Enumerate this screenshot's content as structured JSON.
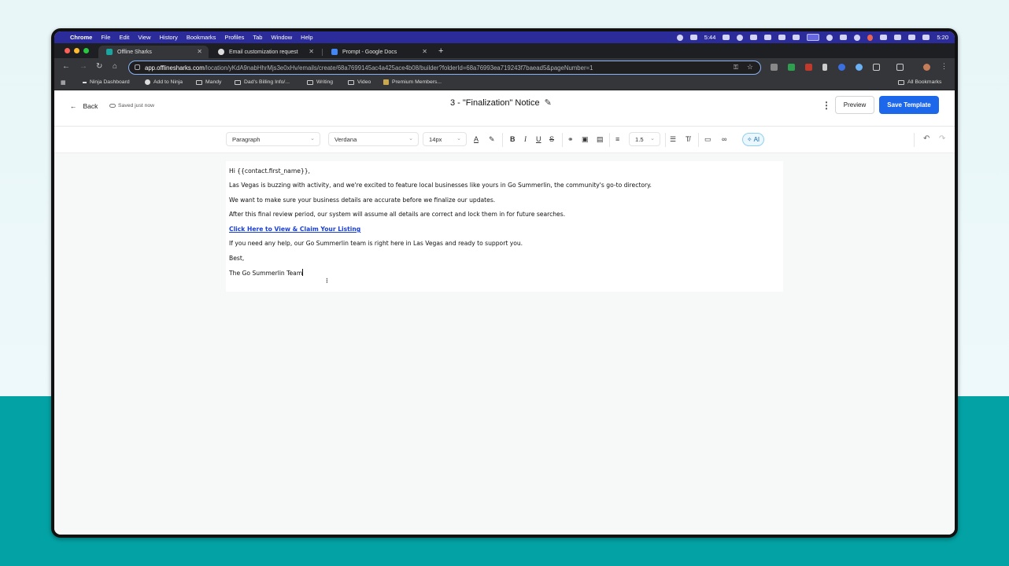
{
  "menubar": {
    "app": "Chrome",
    "items": [
      "File",
      "Edit",
      "View",
      "History",
      "Bookmarks",
      "Profiles",
      "Tab",
      "Window",
      "Help"
    ],
    "timer": "5:44",
    "clock": "5:20"
  },
  "tabs": [
    {
      "label": "Offline Sharks",
      "active": true
    },
    {
      "label": "Email customization request",
      "active": false
    },
    {
      "label": "Prompt - Google Docs",
      "active": false
    }
  ],
  "omnibox": {
    "host": "app.offlinesharks.com",
    "path": "/location/yKdA9nabHhrMjs3e0xHv/emails/create/68a7699145ac4a425ace4b08/builder?folderId=68a76993ea719243f7baead5&pageNumber=1"
  },
  "bookmarks": {
    "items": [
      "Ninja Dashboard",
      "Add to Ninja",
      "Mandy",
      "Dad's Billing Info/...",
      "Writing",
      "Video",
      "Premium Members..."
    ],
    "all": "All Bookmarks"
  },
  "header": {
    "back_label": "Back",
    "saved_label": "Saved just now",
    "title": "3 - \"Finalization\" Notice",
    "preview_label": "Preview",
    "save_label": "Save Template"
  },
  "format_toolbar": {
    "block_type": "Paragraph",
    "font": "Verdana",
    "size": "14px",
    "line_height": "1.5",
    "ai_label": "AI"
  },
  "email": {
    "lines": [
      "Hi {{contact.first_name}},",
      "Las Vegas is buzzing with activity, and we're excited to feature local businesses like yours in Go Summerlin, the community's go-to directory.",
      "We want to make sure your business details are accurate before we finalize our updates.",
      "After this final review period, our system will assume all details are correct and lock them in for future searches.",
      "Click Here to View & Claim Your Listing",
      "If you need any help, our Go Summerlin team is right here in Las Vegas and ready to support you.",
      "Best,",
      "The Go Summerlin Team"
    ]
  },
  "colors": {
    "accent": "#1d68ea",
    "link": "#1a3fd4",
    "menubar": "#2b2c9a",
    "teal_background": "#03a3a5"
  }
}
